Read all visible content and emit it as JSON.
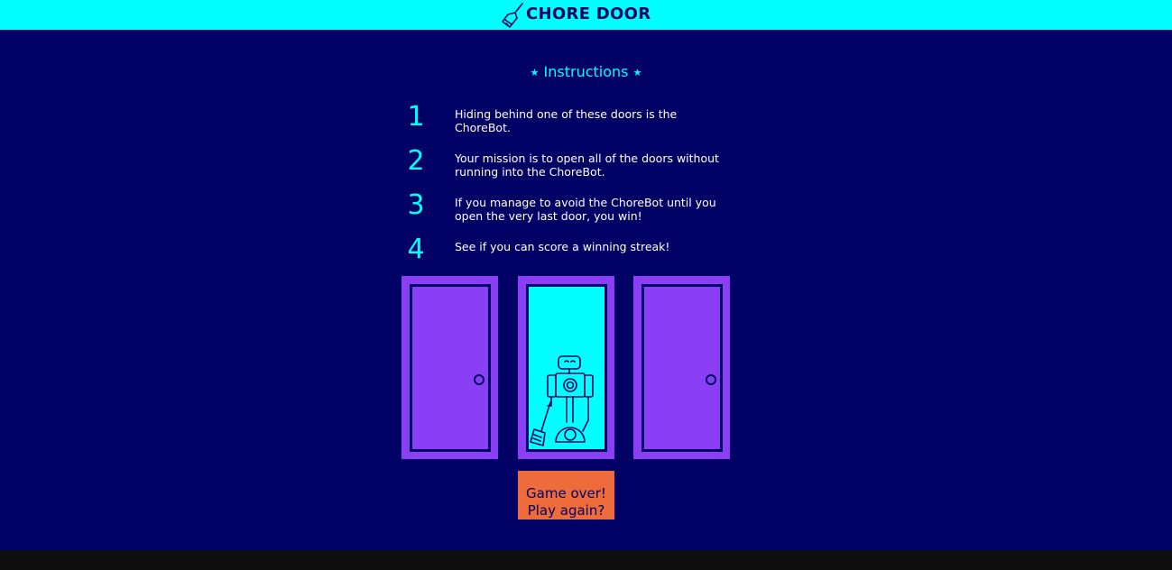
{
  "header": {
    "title": "CHORE DOOR",
    "logo_icon": "broom-icon"
  },
  "instructions": {
    "title": "Instructions",
    "star": "★",
    "steps": [
      {
        "num": "1",
        "text": "Hiding behind one of these doors is the ChoreBot."
      },
      {
        "num": "2",
        "text": "Your mission is to open all of the doors without running into the ChoreBot."
      },
      {
        "num": "3",
        "text": "If you manage to avoid the ChoreBot until you open the very last door, you win!"
      },
      {
        "num": "4",
        "text": "See if you can score a winning streak!"
      }
    ]
  },
  "doors": [
    {
      "state": "closed"
    },
    {
      "state": "open",
      "content": "chorebot-icon"
    },
    {
      "state": "closed"
    }
  ],
  "start_button": {
    "line1": "Game over!",
    "line2": "Play again?"
  },
  "colors": {
    "header_bg": "#00ffff",
    "page_bg": "#010165",
    "door": "#8a3ff5",
    "button": "#ee6b3b"
  }
}
